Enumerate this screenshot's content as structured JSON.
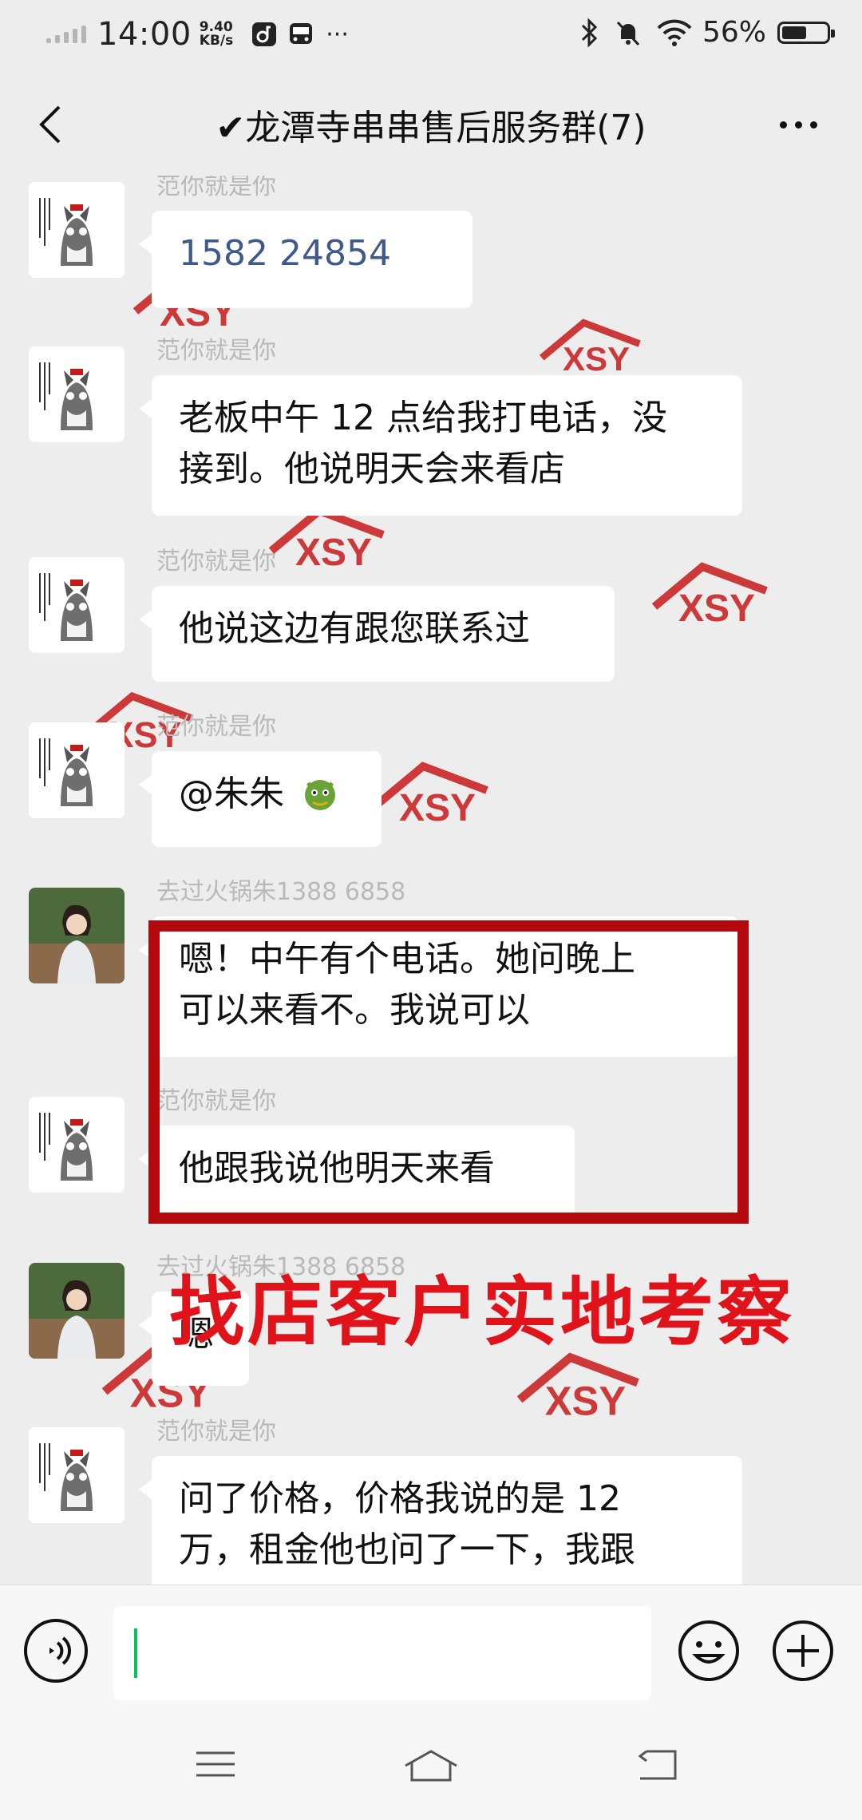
{
  "status_bar": {
    "time": "14:00",
    "net_speed_value": "9.40",
    "net_speed_unit": "KB/s",
    "more": "···",
    "battery": "56%",
    "battery_level": 0.56
  },
  "header": {
    "title": "✔龙潭寺串串售后服务群(7)"
  },
  "messages": [
    {
      "sender": "范你就是你",
      "text": "1582   24854"
    },
    {
      "sender": "范你就是你",
      "lines": [
        "老板中午 12 点给我打电话，没",
        "接到。他说明天会来看店"
      ]
    },
    {
      "sender": "范你就是你",
      "text": "他说这边有跟您联系过"
    },
    {
      "sender": "范你就是你",
      "text": "@朱朱"
    },
    {
      "sender": "去过火锅朱1388    6858",
      "lines": [
        "嗯！中午有个电话。她问晚上",
        "可以来看不。我说可以"
      ]
    },
    {
      "sender": "范你就是你",
      "text": "他跟我说他明天来看"
    },
    {
      "sender": "去过火锅朱1388    6858",
      "text": "嗯"
    },
    {
      "sender": "范你就是你",
      "lines": [
        "问了价格，价格我说的是 12",
        "万，租金他也问了一下，我跟"
      ]
    }
  ],
  "overlay_caption": "找店客户实地考察",
  "watermark_text": "XSY",
  "colors": {
    "accent_red": "#e0121a",
    "box_red": "#b3080c",
    "cursor_green": "#07c160"
  }
}
